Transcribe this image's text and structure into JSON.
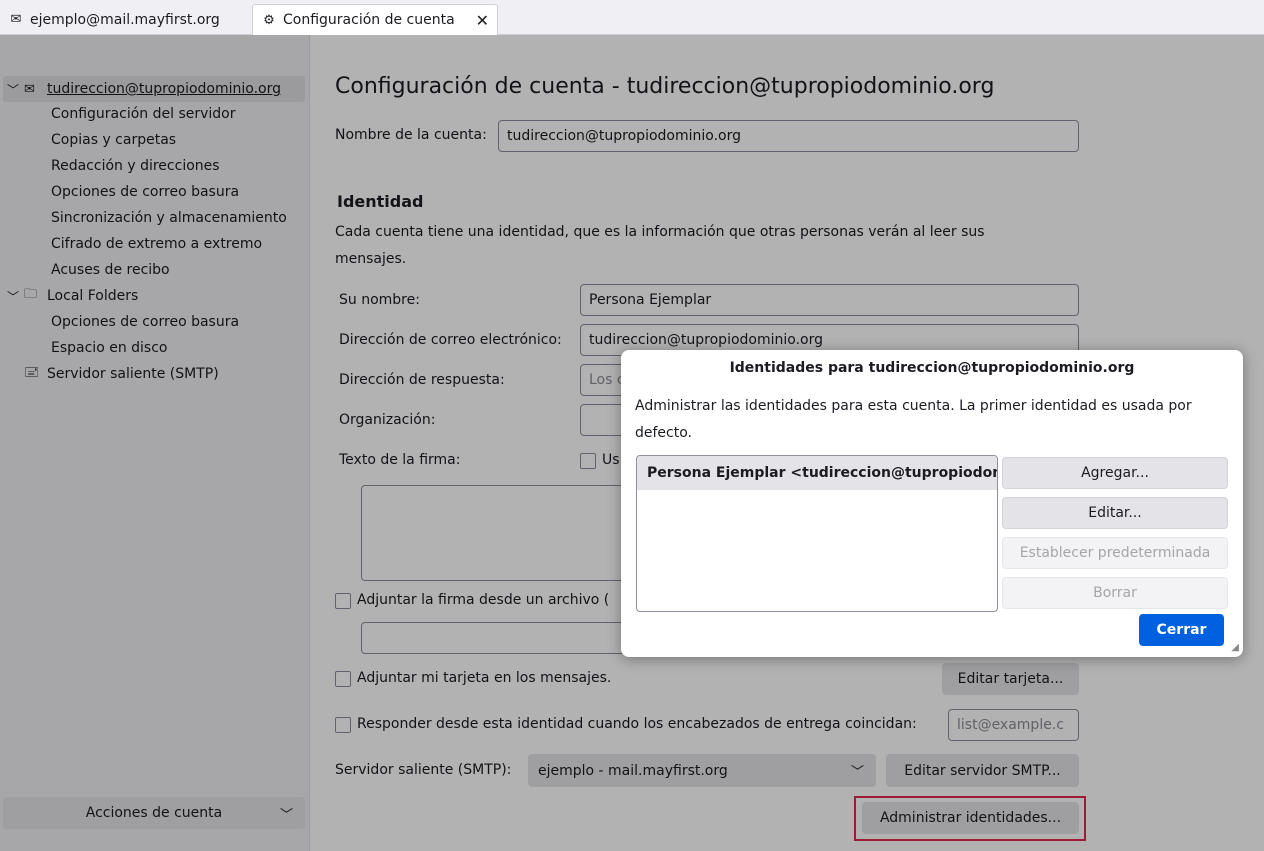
{
  "tabs": [
    {
      "label": "ejemplo@mail.mayfirst.org",
      "icon": "mail-icon"
    },
    {
      "label": "Configuración de cuenta",
      "icon": "settings-icon",
      "active": true
    }
  ],
  "sidebar": {
    "account": "tudireccion@tupropiodominio.org",
    "account_items": [
      "Configuración del servidor",
      "Copias y carpetas",
      "Redacción y direcciones",
      "Opciones de correo basura",
      "Sincronización y almacenamiento",
      "Cifrado de extremo a extremo",
      "Acuses de recibo"
    ],
    "local_folders": "Local Folders",
    "local_items": [
      "Opciones de correo basura",
      "Espacio en disco"
    ],
    "smtp": "Servidor saliente (SMTP)",
    "actions": "Acciones de cuenta"
  },
  "main": {
    "title": "Configuración de cuenta - tudireccion@tupropiodominio.org",
    "account_name_label": "Nombre de la cuenta:",
    "account_name_value": "tudireccion@tupropiodominio.org",
    "identity_heading": "Identidad",
    "identity_desc": "Cada cuenta tiene una identidad, que es la información que otras personas verán al leer sus mensajes.",
    "name_label": "Su nombre:",
    "name_value": "Persona Ejemplar",
    "email_label": "Dirección de correo electrónico:",
    "email_value": "tudireccion@tupropiodominio.org",
    "reply_label": "Dirección de respuesta:",
    "reply_placeholder": "Los c",
    "org_label": "Organización:",
    "sig_label": "Texto de la firma:",
    "sig_checkbox": "Us",
    "attach_sig_label": "Adjuntar la firma desde un archivo (",
    "attach_card_label": "Adjuntar mi tarjeta en los mensajes.",
    "edit_card_button": "Editar tarjeta...",
    "reply_identity_label": "Responder desde esta identidad cuando los encabezados de entrega coincidan:",
    "reply_identity_placeholder": "list@example.c",
    "smtp_label": "Servidor saliente (SMTP):",
    "smtp_value": "ejemplo - mail.mayfirst.org",
    "edit_smtp_button": "Editar servidor SMTP...",
    "manage_identities_button": "Administrar identidades..."
  },
  "dialog": {
    "title": "Identidades para tudireccion@tupropiodominio.org",
    "description": "Administrar las identidades para esta cuenta. La primer identidad es usada por defecto.",
    "identities": [
      "Persona Ejemplar <tudireccion@tupropiodominio.org>"
    ],
    "add_button": "Agregar...",
    "edit_button": "Editar...",
    "default_button": "Establecer predeterminada",
    "delete_button": "Borrar",
    "close_button": "Cerrar"
  },
  "colors": {
    "accent": "#0061e0",
    "highlight": "#e22850"
  }
}
